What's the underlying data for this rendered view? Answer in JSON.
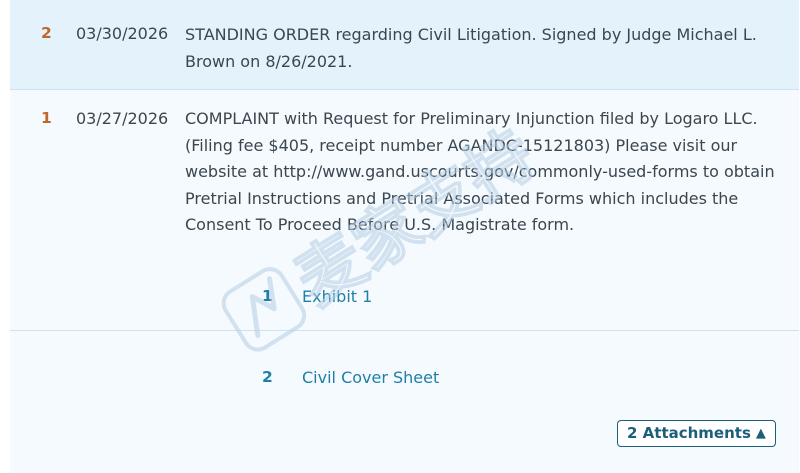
{
  "entries": [
    {
      "number": "2",
      "date": "03/30/2026",
      "text": "STANDING ORDER regarding Civil Litigation. Signed by Judge Michael L. Brown on 8/26/2021."
    },
    {
      "number": "1",
      "date": "03/27/2026",
      "text": "COMPLAINT with Request for Preliminary Injunction filed by Logaro LLC. (Filing fee $405, receipt number AGANDC-15121803) Please visit our website at http://www.gand.uscourts.gov/commonly-used-forms to obtain Pretrial Instructions and Pretrial Associated Forms which includes the Consent To Proceed Before U.S. Magistrate form.",
      "attachments": [
        {
          "number": "1",
          "label": "Exhibit 1"
        },
        {
          "number": "2",
          "label": "Civil Cover Sheet"
        }
      ],
      "attachments_toggle": {
        "label": "2 Attachments",
        "icon": "caret-up-icon",
        "glyph": "▲"
      }
    }
  ],
  "watermark": {
    "text": "麦家支持",
    "logo": "watermark-logo"
  },
  "colors": {
    "entry_number": "#c0672c",
    "link": "#1f7fa6",
    "text": "#3b4650",
    "row_highlight": "#e4f3fb",
    "row_background": "#f4fafd"
  }
}
